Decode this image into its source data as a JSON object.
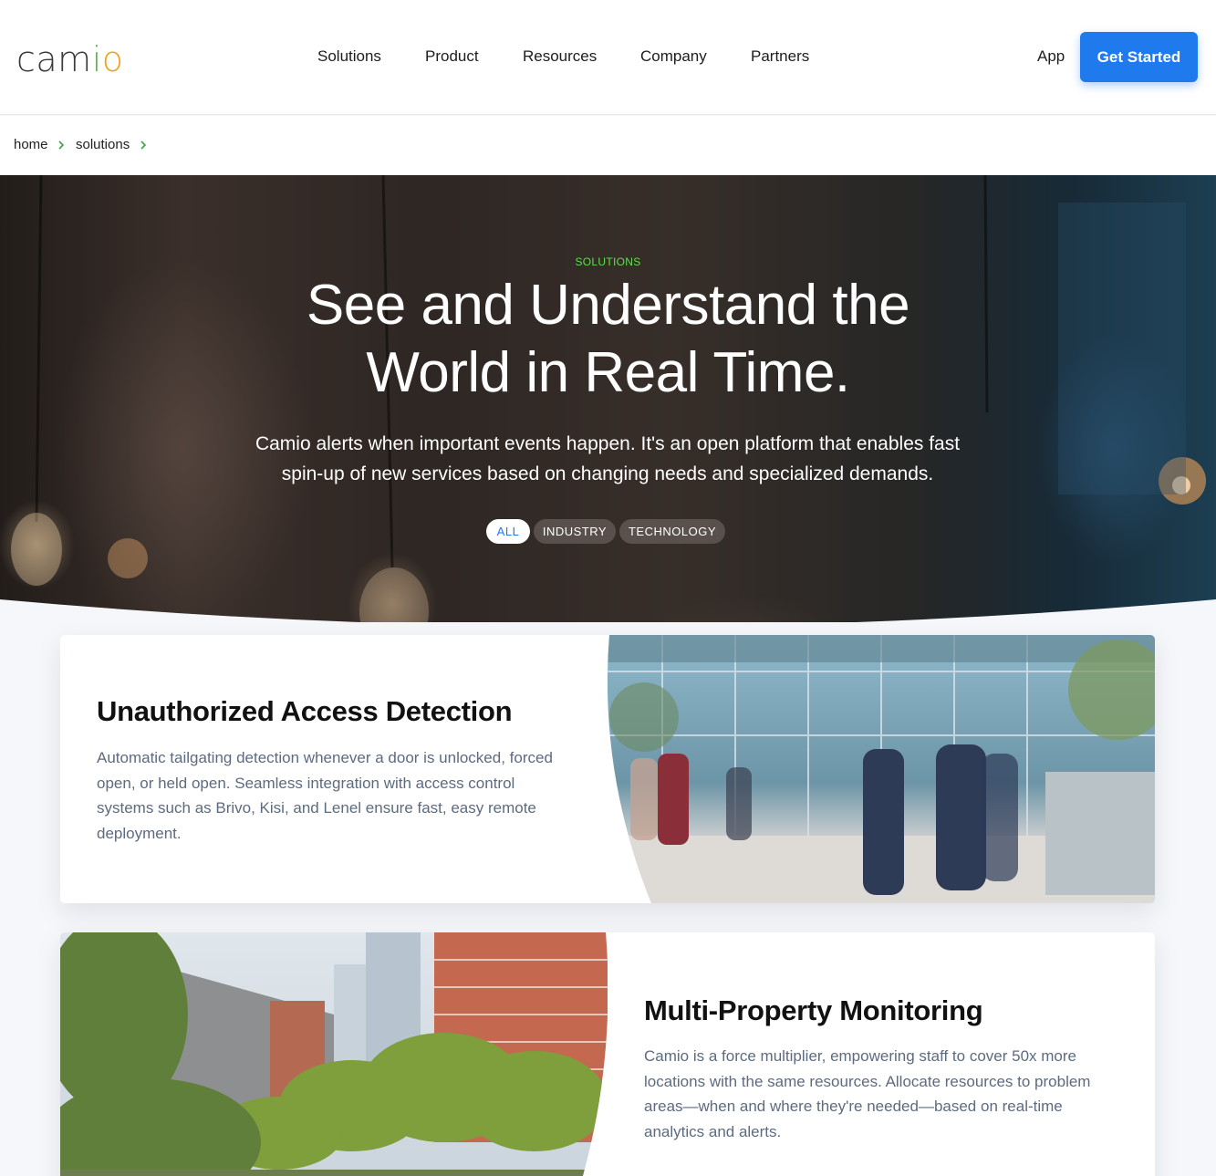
{
  "header": {
    "logo": {
      "c": "cam",
      "i": "i",
      "o": "o"
    },
    "nav": [
      "Solutions",
      "Product",
      "Resources",
      "Company",
      "Partners"
    ],
    "app_label": "App",
    "cta_label": "Get Started"
  },
  "breadcrumb": [
    "home",
    "solutions"
  ],
  "hero": {
    "eyebrow": "SOLUTIONS",
    "title_line1": "See and Understand the",
    "title_line2": "World in Real Time.",
    "subtitle": "Camio alerts when important events happen. It's an open platform that enables fast spin-up of new services based on changing needs and specialized demands.",
    "filters": [
      "ALL",
      "INDUSTRY",
      "TECHNOLOGY"
    ],
    "active_filter": "ALL"
  },
  "cards": [
    {
      "title": "Unauthorized Access Detection",
      "text": "Automatic tailgating detection whenever a door is unlocked, forced open, or held open. Seamless integration with access control systems such as Brivo, Kisi, and Lenel ensure fast, easy remote deployment."
    },
    {
      "title": "Multi-Property Monitoring",
      "text": "Camio is a force multiplier, empowering staff to cover 50x more locations with the same resources. Allocate resources to problem areas—when and where they're needed—based on real-time analytics and alerts."
    }
  ],
  "colors": {
    "accent": "#1f7aee",
    "eyebrow": "#5ce04a",
    "breadcrumb_chevron": "#3aa63a",
    "body_text": "#5d6b80"
  },
  "icons": [
    "chevron-right-icon"
  ]
}
